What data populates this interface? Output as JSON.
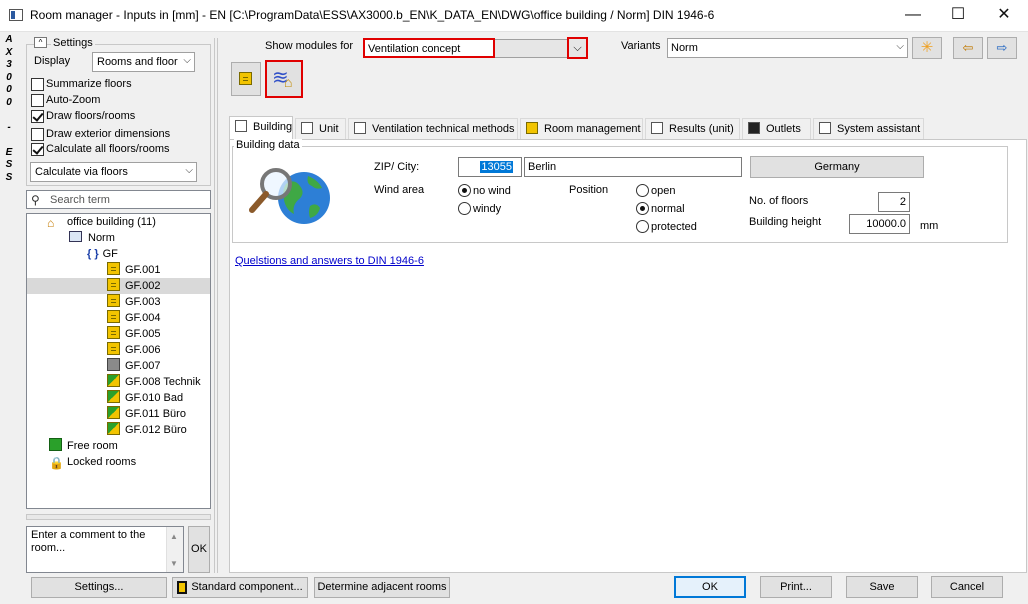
{
  "window": {
    "title": "Room manager - Inputs in [mm] - EN [C:\\ProgramData\\ESS\\AX3000.b_EN\\K_DATA_EN\\DWG\\office building / Norm] DIN 1946-6",
    "minimize": "—",
    "maximize": "☐",
    "close": "✕"
  },
  "brand": "AX3000 - ESS",
  "settings": {
    "header": "Settings",
    "display_label": "Display",
    "display_value": "Rooms and floor",
    "checkboxes": [
      {
        "label": "Summarize floors",
        "checked": false
      },
      {
        "label": "Auto-Zoom",
        "checked": false
      },
      {
        "label": "Draw floors/rooms",
        "checked": true
      },
      {
        "label": "Draw exterior dimensions",
        "checked": false
      },
      {
        "label": "Calculate all floors/rooms",
        "checked": true
      }
    ],
    "calc_value": "Calculate via floors"
  },
  "search": {
    "placeholder": "Search term"
  },
  "tree": {
    "root": "office building (11)",
    "norm": "Norm",
    "floor": "GF",
    "rooms": [
      "GF.001",
      "GF.002",
      "GF.003",
      "GF.004",
      "GF.005",
      "GF.006",
      "GF.007",
      "GF.008 Technik",
      "GF.010 Bad",
      "GF.011 Büro",
      "GF.012 Büro"
    ],
    "selected": "GF.002",
    "free_room": "Free room",
    "locked_rooms": "Locked rooms"
  },
  "comment": {
    "placeholder": "Enter a comment to the room...",
    "ok": "OK"
  },
  "modules": {
    "label": "Show modules for",
    "value": "Ventilation concept",
    "variants_label": "Variants",
    "variants_value": "Norm"
  },
  "tabs": [
    "Building",
    "Unit",
    "Ventilation technical methods",
    "Room management",
    "Results (unit)",
    "Outlets",
    "System assistant"
  ],
  "building": {
    "group": "Building data",
    "zip_label": "ZIP/ City:",
    "zip": "13055",
    "city": "Berlin",
    "country": "Germany",
    "wind_label": "Wind area",
    "wind_options": [
      "no wind",
      "windy"
    ],
    "wind_selected": "no wind",
    "position_label": "Position",
    "position_options": [
      "open",
      "normal",
      "protected"
    ],
    "position_selected": "normal",
    "floors_label": "No. of floors",
    "floors": "2",
    "height_label": "Building height",
    "height": "10000.0",
    "height_unit": "mm",
    "link": "Quelstions and answers to DIN 1946-6"
  },
  "bottom_buttons": {
    "settings": "Settings...",
    "standard": "Standard component...",
    "adjacent": "Determine adjacent rooms",
    "ok": "OK",
    "print": "Print...",
    "save": "Save",
    "cancel": "Cancel"
  }
}
